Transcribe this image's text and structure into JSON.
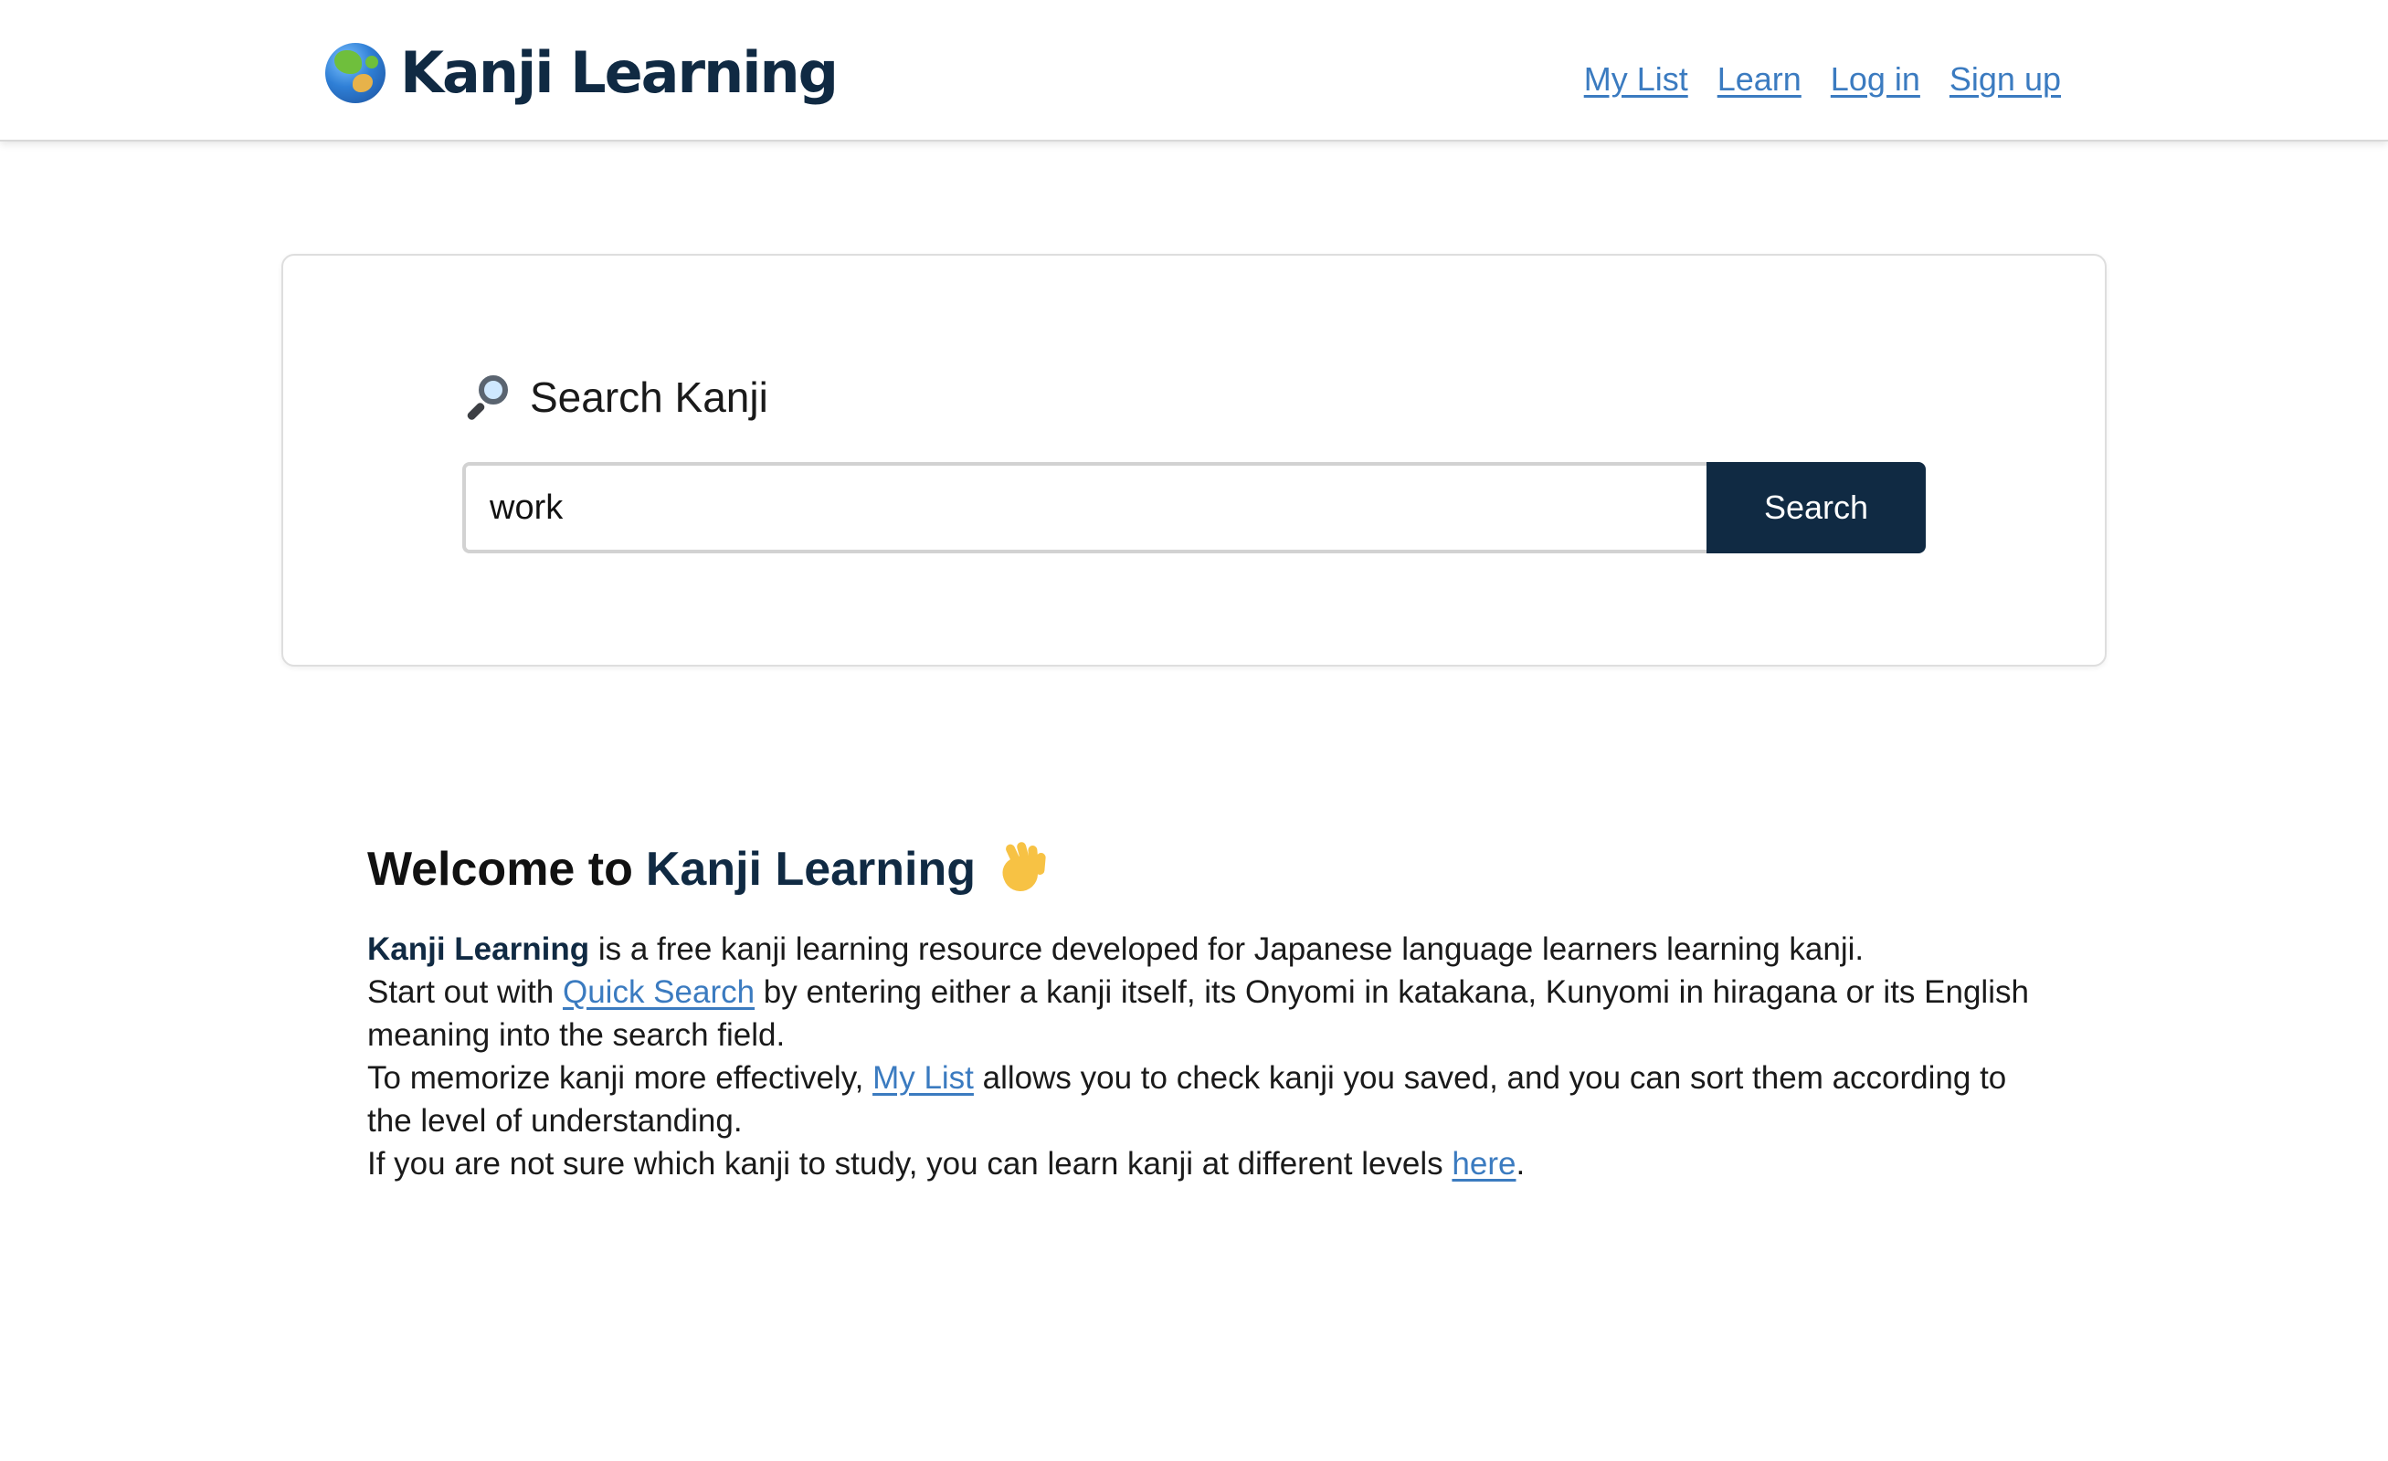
{
  "header": {
    "brand_title": "Kanji Learning",
    "brand_icon": "globe-icon",
    "nav": {
      "my_list": "My List",
      "learn": "Learn",
      "log_in": "Log in",
      "sign_up": "Sign up"
    }
  },
  "search": {
    "heading": "Search Kanji",
    "heading_icon": "magnifier-icon",
    "input_value": "work",
    "button_label": "Search"
  },
  "welcome": {
    "title_prefix": "Welcome to",
    "title_brand": "Kanji Learning",
    "title_icon": "waving-hand-icon",
    "line1_brand": "Kanji Learning",
    "line1_rest": " is a free kanji learning resource developed for Japanese language learners learning kanji.",
    "line2_start": "Start out with ",
    "line2_link": "Quick Search",
    "line2_rest": " by entering either a kanji itself, its Onyomi in katakana, Kunyomi in hiragana or its English meaning into the search field.",
    "line3_start": "To memorize kanji more effectively, ",
    "line3_link": "My List",
    "line3_rest": " allows you to check kanji you saved, and you can sort them according to the level of understanding.",
    "line4_start": "If you are not sure which kanji to study, you can learn kanji at different levels ",
    "line4_link": "here",
    "line4_end": "."
  },
  "colors": {
    "brand_navy": "#102a43",
    "link_blue": "#3b7bc0",
    "border_gray": "#dedede"
  }
}
